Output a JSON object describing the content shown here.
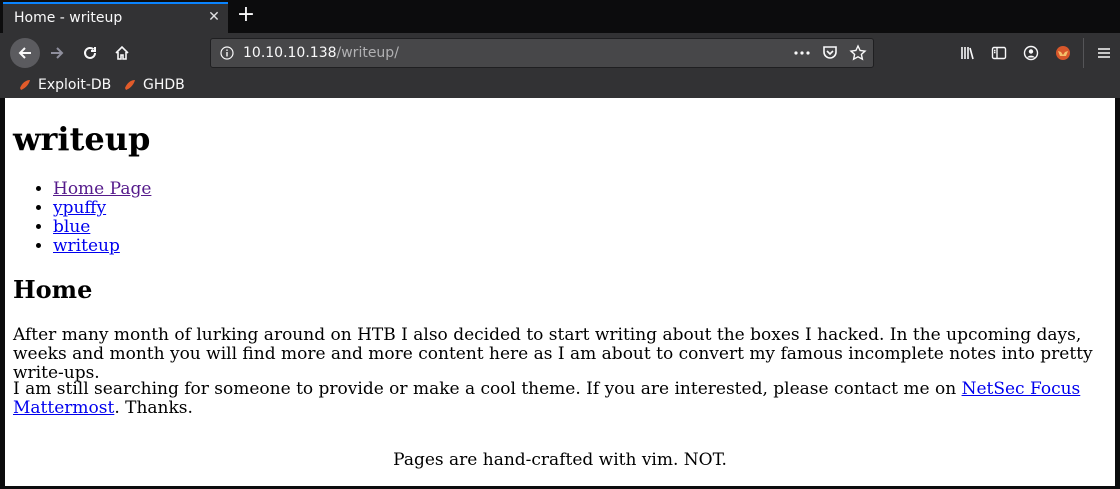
{
  "tab": {
    "title": "Home - writeup"
  },
  "url": {
    "host": "10.10.10.138",
    "path": "/writeup/"
  },
  "bookmarks": [
    {
      "label": "Exploit-DB"
    },
    {
      "label": "GHDB"
    }
  ],
  "page": {
    "heading": "writeup",
    "nav": [
      {
        "label": "Home Page"
      },
      {
        "label": "ypuffy"
      },
      {
        "label": "blue"
      },
      {
        "label": "writeup"
      }
    ],
    "section_title": "Home",
    "paragraph1": "After many month of lurking around on HTB I also decided to start writing about the boxes I hacked. In the upcoming days, weeks and month you will find more and more content here as I am about to convert my famous incomplete notes into pretty write-ups.",
    "paragraph2_before": "I am still searching for someone to provide or make a cool theme. If you are interested, please contact me on ",
    "paragraph2_link": "NetSec Focus Mattermost",
    "paragraph2_after": ". Thanks.",
    "footer": "Pages are hand-crafted with vim. NOT."
  },
  "colors": {
    "accent": "#0a84ff",
    "link": "#0000ee",
    "visited_link": "#551a8b"
  }
}
